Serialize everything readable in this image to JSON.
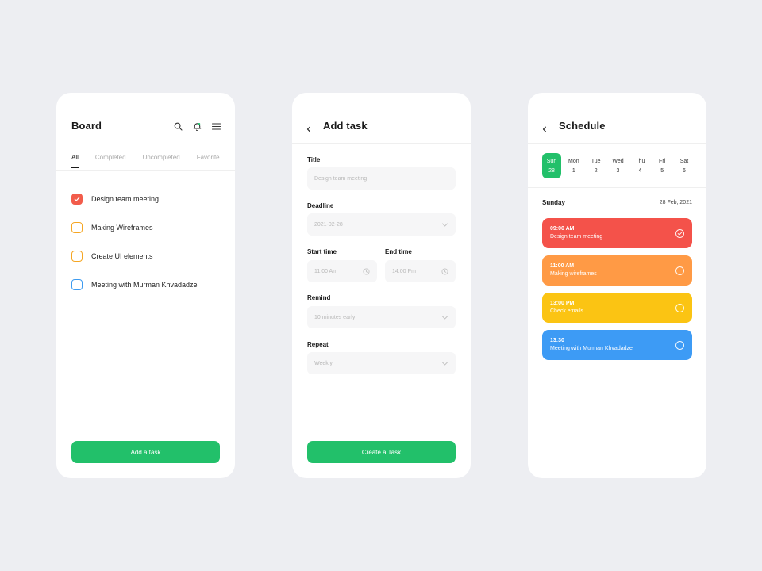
{
  "board": {
    "title": "Board",
    "tabs": [
      "All",
      "Completed",
      "Uncompleted",
      "Favorite"
    ],
    "tasks": [
      {
        "label": "Design team meeting",
        "state": "checked"
      },
      {
        "label": "Making Wireframes",
        "state": "unchecked"
      },
      {
        "label": "Create UI elements",
        "state": "unchecked"
      },
      {
        "label": "Meeting with Murman Khvadadze",
        "state": "unchecked"
      }
    ],
    "add_button": "Add a task",
    "icons": [
      "search-icon",
      "bell-icon",
      "menu-icon"
    ]
  },
  "addtask": {
    "title": "Add task",
    "title_label": "Title",
    "title_placeholder": "Design team meeting",
    "deadline_label": "Deadline",
    "deadline_value": "2021-02-28",
    "start_label": "Start time",
    "start_value": "11:00 Am",
    "end_label": "End time",
    "end_value": "14:00 Pm",
    "remind_label": "Remind",
    "remind_value": "10 minutes early",
    "repeat_label": "Repeat",
    "repeat_value": "Weekly",
    "create_button": "Create a Task"
  },
  "schedule": {
    "title": "Schedule",
    "days": [
      {
        "name": "Sun",
        "num": "28",
        "selected": true
      },
      {
        "name": "Mon",
        "num": "1",
        "selected": false
      },
      {
        "name": "Tue",
        "num": "2",
        "selected": false
      },
      {
        "name": "Wed",
        "num": "3",
        "selected": false
      },
      {
        "name": "Thu",
        "num": "4",
        "selected": false
      },
      {
        "name": "Fri",
        "num": "5",
        "selected": false
      },
      {
        "name": "Sat",
        "num": "6",
        "selected": false
      }
    ],
    "section_day": "Sunday",
    "section_date": "28 Feb, 2021",
    "events": [
      {
        "time": "09:00 AM",
        "title": "Design team meeting",
        "color": "#F4524A",
        "done": true
      },
      {
        "time": "11:00 AM",
        "title": "Making wireframes",
        "color": "#FF9A45",
        "done": false
      },
      {
        "time": "13:00 PM",
        "title": "Check emails",
        "color": "#FBC413",
        "done": false
      },
      {
        "time": "13:30",
        "title": "Meeting with Murman Khvadadze",
        "color": "#3D9BF5",
        "done": false
      }
    ]
  },
  "colors": {
    "accent_green": "#22C06A",
    "background": "#EDEEF2"
  }
}
